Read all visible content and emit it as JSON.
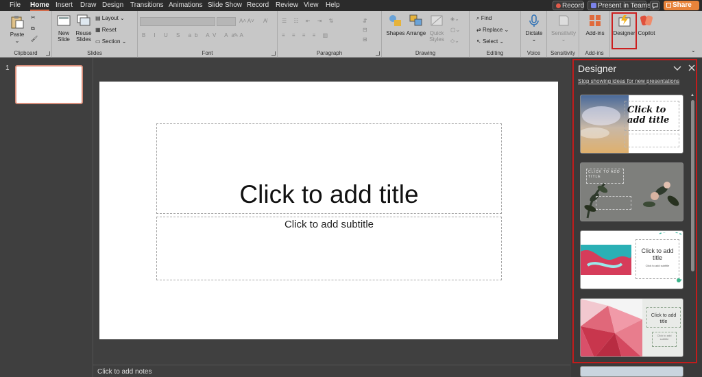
{
  "menu": {
    "tabs": [
      "File",
      "Home",
      "Insert",
      "Draw",
      "Design",
      "Transitions",
      "Animations",
      "Slide Show",
      "Record",
      "Review",
      "View",
      "Help"
    ],
    "active_tab": "Home",
    "record_label": "Record",
    "present_label": "Present in Teams",
    "share_label": "Share"
  },
  "ribbon": {
    "clipboard": {
      "paste": "Paste",
      "group": "Clipboard"
    },
    "slides": {
      "new_slide": "New Slide",
      "reuse_slides": "Reuse Slides",
      "layout": "Layout",
      "reset": "Reset",
      "section": "Section",
      "group": "Slides"
    },
    "font": {
      "group": "Font"
    },
    "paragraph": {
      "group": "Paragraph"
    },
    "drawing": {
      "shapes": "Shapes",
      "arrange": "Arrange",
      "quick_styles": "Quick Styles",
      "group": "Drawing"
    },
    "editing": {
      "find": "Find",
      "replace": "Replace",
      "select": "Select",
      "group": "Editing"
    },
    "voice": {
      "dictate": "Dictate",
      "group": "Voice"
    },
    "sensitivity": {
      "label": "Sensitivity",
      "group": "Sensitivity"
    },
    "addins": {
      "label": "Add-ins",
      "group": "Add-ins"
    },
    "designer": {
      "label": "Designer"
    },
    "copilot": {
      "label": "Copilot"
    }
  },
  "slides_panel": {
    "number": "1"
  },
  "slide": {
    "title_placeholder": "Click to add title",
    "subtitle_placeholder": "Click to add subtitle"
  },
  "notes": {
    "placeholder": "Click to add notes"
  },
  "designer_pane": {
    "title": "Designer",
    "stop_link": "Stop showing ideas for new presentations",
    "ideas": [
      {
        "title": "Click to add title"
      },
      {
        "title": "CLICK TO ADD TITLE"
      },
      {
        "title": "Click to add title",
        "subtitle": "Click to add subtitle"
      },
      {
        "title": "Click to add title",
        "subtitle": "Click to add subtitle"
      }
    ]
  },
  "colors": {
    "accent": "#d36a4a",
    "share": "#e8833a",
    "highlight": "#cc1f1f",
    "ribbon": "#c7c7c7"
  }
}
